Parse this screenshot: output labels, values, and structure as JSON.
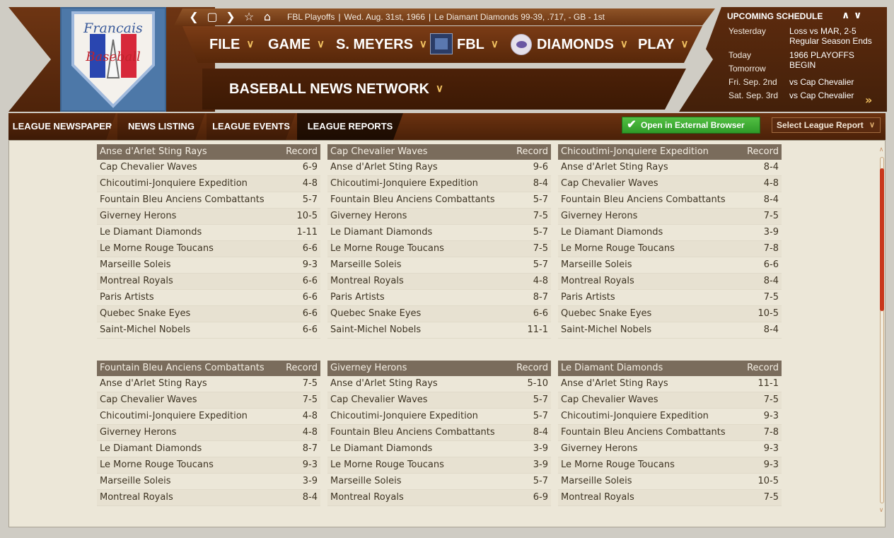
{
  "colors": {
    "wood_dark": "#4b2108",
    "accent_gold": "#f0c060",
    "button_green": "#3aa42f",
    "table_header": "#7a6c5c",
    "content_bg": "#ece7d8",
    "scroll_thumb": "#c9371c"
  },
  "logo": {
    "text_line1": "Francais",
    "text_line2": "Baseball"
  },
  "topbar": {
    "nav_back": "❮",
    "nav_square": "▢",
    "nav_forward": "❯",
    "nav_star": "☆",
    "nav_home": "⌂",
    "status": [
      "FBL Playoffs",
      "Wed. Aug. 31st, 1966",
      "Le Diamant Diamonds  99-39, .717, - GB - 1st"
    ]
  },
  "menu": [
    {
      "label": "FILE",
      "icon": ""
    },
    {
      "label": "GAME",
      "icon": ""
    },
    {
      "label": "S. MEYERS",
      "icon": ""
    },
    {
      "label": "FBL",
      "icon": "league-logo-icon"
    },
    {
      "label": "DIAMONDS",
      "icon": "team-logo-icon"
    },
    {
      "label": "PLAY",
      "icon": ""
    }
  ],
  "chevron": "∨",
  "section": {
    "title": "BASEBALL NEWS NETWORK"
  },
  "schedule": {
    "title": "UPCOMING SCHEDULE",
    "up": "∧",
    "down": "∨",
    "more": "»",
    "rows": [
      {
        "day": "Yesterday",
        "value": "Loss vs MAR, 2-5\nRegular Season Ends"
      },
      {
        "day": "Today",
        "value": "1966 PLAYOFFS BEGIN"
      },
      {
        "day": "Tomorrow",
        "value": ""
      },
      {
        "day": "Fri. Sep. 2nd",
        "value": "vs Cap Chevalier"
      },
      {
        "day": "Sat. Sep. 3rd",
        "value": "vs Cap Chevalier"
      }
    ]
  },
  "tabs": [
    {
      "label": "LEAGUE NEWSPAPER"
    },
    {
      "label": "NEWS LISTING"
    },
    {
      "label": "LEAGUE EVENTS"
    },
    {
      "label": "LEAGUE REPORTS"
    }
  ],
  "actions": {
    "open_external": "Open in External Browser",
    "select_report": "Select League Report"
  },
  "tables": [
    {
      "team": "Anse d'Arlet Sting Rays",
      "record_header": "Record",
      "rows": [
        [
          "Cap Chevalier Waves",
          "6-9"
        ],
        [
          "Chicoutimi-Jonquiere Expedition",
          "4-8"
        ],
        [
          "Fountain Bleu Anciens Combattants",
          "5-7"
        ],
        [
          "Giverney Herons",
          "10-5"
        ],
        [
          "Le Diamant Diamonds",
          "1-11"
        ],
        [
          "Le Morne Rouge Toucans",
          "6-6"
        ],
        [
          "Marseille Soleis",
          "9-3"
        ],
        [
          "Montreal Royals",
          "6-6"
        ],
        [
          "Paris Artists",
          "6-6"
        ],
        [
          "Quebec Snake Eyes",
          "6-6"
        ],
        [
          "Saint-Michel Nobels",
          "6-6"
        ]
      ]
    },
    {
      "team": "Cap Chevalier Waves",
      "record_header": "Record",
      "rows": [
        [
          "Anse d'Arlet Sting Rays",
          "9-6"
        ],
        [
          "Chicoutimi-Jonquiere Expedition",
          "8-4"
        ],
        [
          "Fountain Bleu Anciens Combattants",
          "5-7"
        ],
        [
          "Giverney Herons",
          "7-5"
        ],
        [
          "Le Diamant Diamonds",
          "5-7"
        ],
        [
          "Le Morne Rouge Toucans",
          "7-5"
        ],
        [
          "Marseille Soleis",
          "5-7"
        ],
        [
          "Montreal Royals",
          "4-8"
        ],
        [
          "Paris Artists",
          "8-7"
        ],
        [
          "Quebec Snake Eyes",
          "6-6"
        ],
        [
          "Saint-Michel Nobels",
          "11-1"
        ]
      ]
    },
    {
      "team": "Chicoutimi-Jonquiere Expedition",
      "record_header": "Record",
      "rows": [
        [
          "Anse d'Arlet Sting Rays",
          "8-4"
        ],
        [
          "Cap Chevalier Waves",
          "4-8"
        ],
        [
          "Fountain Bleu Anciens Combattants",
          "8-4"
        ],
        [
          "Giverney Herons",
          "7-5"
        ],
        [
          "Le Diamant Diamonds",
          "3-9"
        ],
        [
          "Le Morne Rouge Toucans",
          "7-8"
        ],
        [
          "Marseille Soleis",
          "6-6"
        ],
        [
          "Montreal Royals",
          "8-4"
        ],
        [
          "Paris Artists",
          "7-5"
        ],
        [
          "Quebec Snake Eyes",
          "10-5"
        ],
        [
          "Saint-Michel Nobels",
          "8-4"
        ]
      ]
    },
    {
      "team": "Fountain Bleu Anciens Combattants",
      "record_header": "Record",
      "rows": [
        [
          "Anse d'Arlet Sting Rays",
          "7-5"
        ],
        [
          "Cap Chevalier Waves",
          "7-5"
        ],
        [
          "Chicoutimi-Jonquiere Expedition",
          "4-8"
        ],
        [
          "Giverney Herons",
          "4-8"
        ],
        [
          "Le Diamant Diamonds",
          "8-7"
        ],
        [
          "Le Morne Rouge Toucans",
          "9-3"
        ],
        [
          "Marseille Soleis",
          "3-9"
        ],
        [
          "Montreal Royals",
          "8-4"
        ]
      ]
    },
    {
      "team": "Giverney Herons",
      "record_header": "Record",
      "rows": [
        [
          "Anse d'Arlet Sting Rays",
          "5-10"
        ],
        [
          "Cap Chevalier Waves",
          "5-7"
        ],
        [
          "Chicoutimi-Jonquiere Expedition",
          "5-7"
        ],
        [
          "Fountain Bleu Anciens Combattants",
          "8-4"
        ],
        [
          "Le Diamant Diamonds",
          "3-9"
        ],
        [
          "Le Morne Rouge Toucans",
          "3-9"
        ],
        [
          "Marseille Soleis",
          "5-7"
        ],
        [
          "Montreal Royals",
          "6-9"
        ]
      ]
    },
    {
      "team": "Le Diamant Diamonds",
      "record_header": "Record",
      "rows": [
        [
          "Anse d'Arlet Sting Rays",
          "11-1"
        ],
        [
          "Cap Chevalier Waves",
          "7-5"
        ],
        [
          "Chicoutimi-Jonquiere Expedition",
          "9-3"
        ],
        [
          "Fountain Bleu Anciens Combattants",
          "7-8"
        ],
        [
          "Giverney Herons",
          "9-3"
        ],
        [
          "Le Morne Rouge Toucans",
          "9-3"
        ],
        [
          "Marseille Soleis",
          "10-5"
        ],
        [
          "Montreal Royals",
          "7-5"
        ]
      ]
    }
  ]
}
